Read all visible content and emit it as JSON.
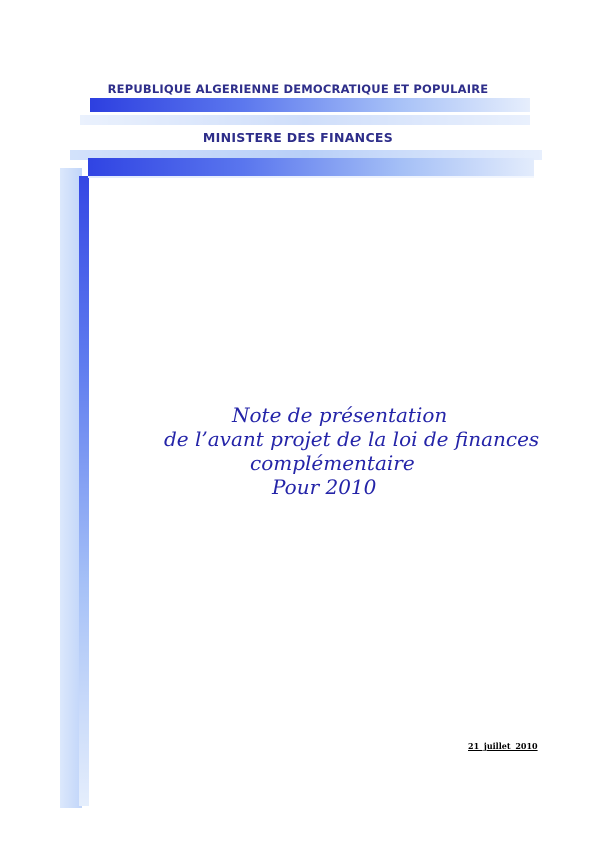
{
  "header": {
    "republic": "REPUBLIQUE ALGERIENNE DEMOCRATIQUE ET POPULAIRE",
    "ministry": "MINISTERE DES FINANCES"
  },
  "title": {
    "line1": "Note de présentation",
    "line2": "de l’avant projet de la loi de finances",
    "line3": "complémentaire",
    "line4": "Pour 2010"
  },
  "date": "21 juillet 2010",
  "colors": {
    "header_text": "#2e2e8a",
    "title_text": "#2424a8",
    "bar_dark": "#2d3fe0",
    "bar_light": "#e6eefc"
  }
}
